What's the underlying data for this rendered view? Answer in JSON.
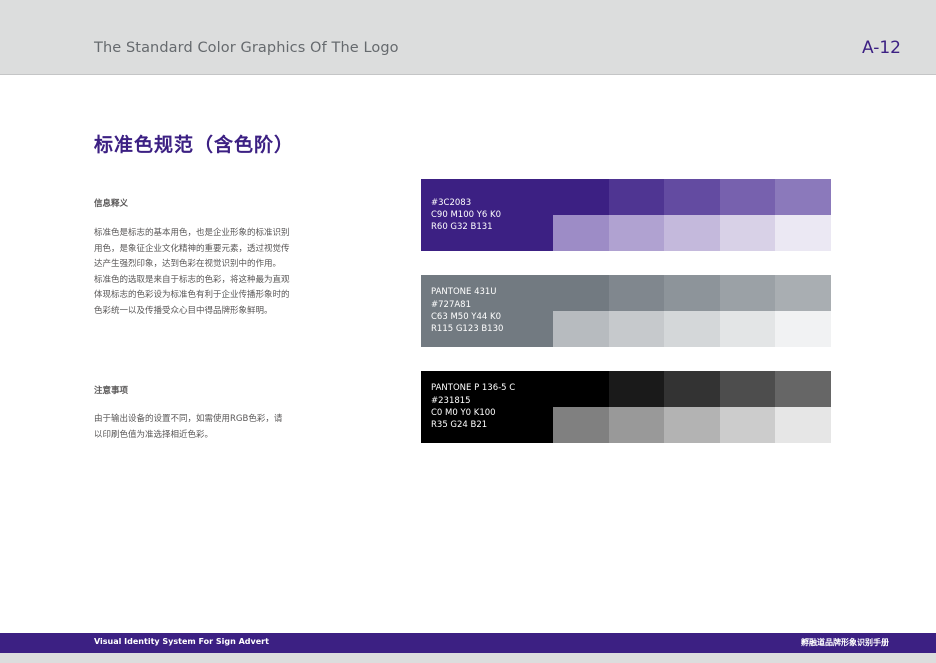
{
  "header": {
    "title": "The Standard Color Graphics Of The Logo",
    "page_number": "A-12"
  },
  "section": {
    "title": "标准色规范（含色阶）"
  },
  "info": {
    "heading": "信息释义",
    "paragraph1": "标准色是标志的基本用色，也是企业形象的标准识别用色，是象征企业文化精神的重要元素，透过视觉传达产生强烈印象，达到色彩在视觉识别中的作用。",
    "paragraph2": "标准色的选取是来自于标志的色彩，将这种最为直观体现标志的色彩设为标准色有利于企业传播形象时的色彩统一以及传播受众心目中得品牌形象鲜明。"
  },
  "notes": {
    "heading": "注意事项",
    "paragraph": "由于输出设备的设置不同，如需使用RGB色彩，请以印刷色值为准选择相近色彩。"
  },
  "swatches": [
    {
      "lines": [
        "#3C2083",
        "C90 M100 Y6 K0",
        "R60 G32 B131"
      ],
      "color": "#3c2083",
      "tints": [
        "#3c2083",
        "#4f3592",
        "#634ba1",
        "#7761ae",
        "#8b79bb",
        "#9d8cc6",
        "#b0a2d1",
        "#c4b9dc",
        "#d8d1e7",
        "#ebe8f3"
      ]
    },
    {
      "lines": [
        "PANTONE  431U",
        "#727A81",
        "C63 M50 Y44 K0",
        "R115 G123 B130"
      ],
      "color": "#727a81",
      "tints": [
        "#727a81",
        "#80878e",
        "#8d949a",
        "#9ba1a6",
        "#a9aeb2",
        "#b7bbbf",
        "#c6c9cc",
        "#d4d7d9",
        "#e3e5e6",
        "#f1f2f3"
      ]
    },
    {
      "lines": [
        "PANTONE P 136-5 C",
        "#231815",
        "C0 M0 Y0 K100",
        "R35 G24 B21"
      ],
      "color": "#000000",
      "tints": [
        "#000000",
        "#1a1a1a",
        "#333333",
        "#4d4d4d",
        "#666666",
        "#808080",
        "#999999",
        "#b3b3b3",
        "#cccccc",
        "#e6e6e6"
      ]
    }
  ],
  "footer": {
    "left": "Visual Identity System For Sign Advert",
    "right": "孵融道品牌形象识别手册"
  }
}
